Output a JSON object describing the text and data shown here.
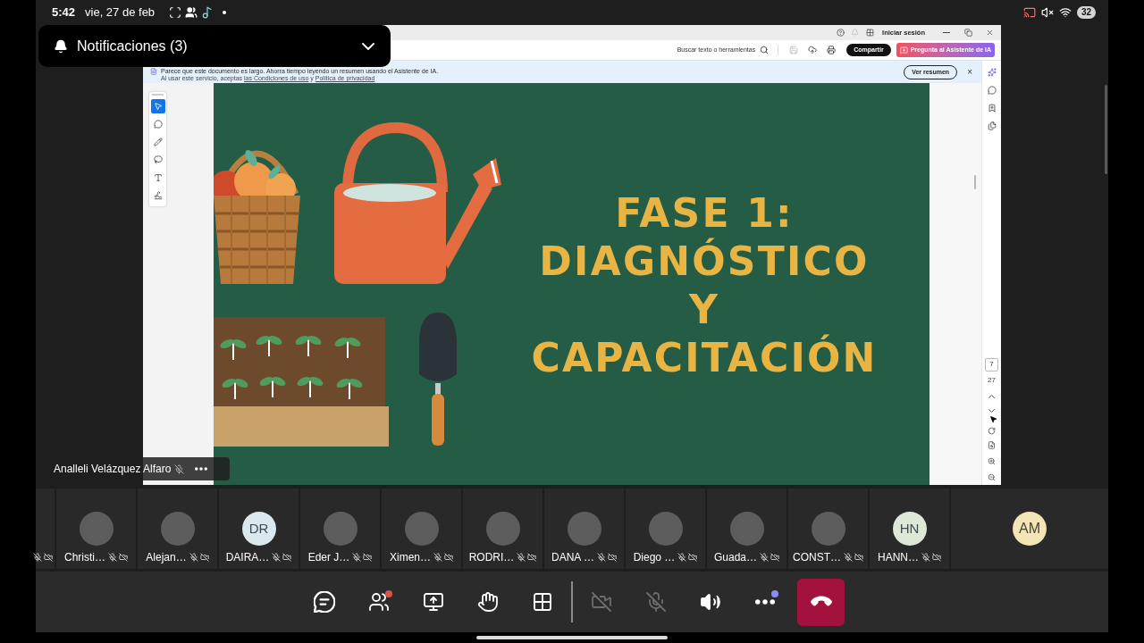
{
  "status_bar": {
    "time": "5:42",
    "date": "vie, 27 de feb",
    "battery": "32"
  },
  "notification": {
    "title": "Notificaciones (3)",
    "expanded": false
  },
  "shared_screen": {
    "title_bar": {
      "sign_in": "Iniciar sesión"
    },
    "toolbar": {
      "search": "Buscar texto o herramientas",
      "share_button": "Compartir",
      "ai_button": "Pregunta al Asistente de IA"
    },
    "banner": {
      "message": "Parece que este documento es largo. Ahorra tiempo leyendo un resumen usando el Asistente de IA.",
      "consent": "Al usar este servicio, aceptas",
      "terms_link": "las Condiciones de uso",
      "connector": "y",
      "privacy_link": "Política de privacidad",
      "summary_button": "Ver resumen",
      "close": "×"
    },
    "tools": [
      {
        "kind": "select",
        "selected": true
      },
      {
        "kind": "comment",
        "selected": false
      },
      {
        "kind": "pen",
        "selected": false
      },
      {
        "kind": "lasso",
        "selected": false
      },
      {
        "kind": "text",
        "selected": false
      },
      {
        "kind": "sign",
        "selected": false
      }
    ],
    "slide": {
      "title_lines": [
        "FASE 1:",
        "DIAGNÓSTICO",
        "Y",
        "CAPACITACIÓN"
      ]
    },
    "page_nav": {
      "current_page": "7",
      "total_pages": "27"
    }
  },
  "presenter": {
    "name": "Analleli Velázquez Alfaro",
    "muted": true
  },
  "participants": [
    {
      "kind": "partial",
      "muted": true,
      "camera_off": true
    },
    {
      "kind": "photo",
      "name": "Christi…",
      "muted": true,
      "camera_off": true
    },
    {
      "kind": "photo",
      "name": "Alejan…",
      "muted": true,
      "camera_off": true
    },
    {
      "kind": "initials",
      "initials": "DR",
      "color": "#dbe8ee",
      "name": "DAIRA…",
      "muted": true,
      "camera_off": true
    },
    {
      "kind": "photo",
      "name": "Eder J…",
      "muted": true,
      "camera_off": true
    },
    {
      "kind": "photo",
      "name": "Ximen…",
      "muted": true,
      "camera_off": true
    },
    {
      "kind": "photo",
      "name": "RODRI…",
      "muted": true,
      "camera_off": true
    },
    {
      "kind": "photo",
      "name": "DANA …",
      "muted": true,
      "camera_off": true
    },
    {
      "kind": "photo",
      "name": "Diego …",
      "muted": true,
      "camera_off": true
    },
    {
      "kind": "photo",
      "name": "Guada…",
      "muted": true,
      "camera_off": true
    },
    {
      "kind": "photo",
      "name": "CONST…",
      "muted": true,
      "camera_off": true
    },
    {
      "kind": "initials",
      "initials": "HN",
      "color": "#dde9d6",
      "name": "HANN…",
      "muted": true,
      "camera_off": true
    }
  ],
  "self_tile": {
    "initials": "AM",
    "color": "#f4e5b6"
  },
  "call_controls": {
    "left": [
      {
        "kind": "chat",
        "disabled": false
      },
      {
        "kind": "people",
        "disabled": false,
        "color": "#d9534f"
      },
      {
        "kind": "share",
        "disabled": false
      },
      {
        "kind": "raise_hand",
        "disabled": false
      },
      {
        "kind": "view",
        "disabled": false
      }
    ],
    "right": [
      {
        "kind": "camera",
        "disabled": true
      },
      {
        "kind": "mic",
        "disabled": true
      },
      {
        "kind": "speaker",
        "disabled": false
      },
      {
        "kind": "more",
        "disabled": false,
        "color": "#8b8cf2"
      },
      {
        "kind": "hang_up",
        "disabled": false
      }
    ]
  }
}
